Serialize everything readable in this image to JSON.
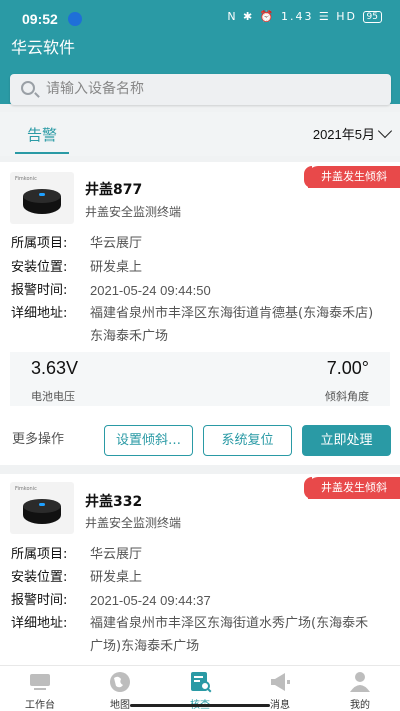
{
  "status": {
    "time": "09:52",
    "right": "N ✱ ⏰ 1.43 ☰ HD",
    "battery": "95"
  },
  "app": {
    "title": "华云软件"
  },
  "search": {
    "placeholder": "请输入设备名称"
  },
  "tabs": {
    "alarm": "告警",
    "date": "2021年5月"
  },
  "labels": {
    "project": "所属项目:",
    "location": "安装位置:",
    "alarm_time": "报警时间:",
    "address": "详细地址:",
    "battery": "电池电压",
    "tilt": "倾斜角度",
    "more": "更多操作",
    "set_tilt": "设置倾斜…",
    "reset": "系统复位",
    "handle": "立即处理"
  },
  "cards": [
    {
      "brand": "Fimkonic",
      "name": "井盖877",
      "type": "井盖安全监测终端",
      "tag": "井盖发生倾斜",
      "project": "华云展厅",
      "location": "研发桌上",
      "alarm_time": "2021-05-24 09:44:50",
      "address": "福建省泉州市丰泽区东海街道肯德基(东海泰禾店)东海泰禾广场",
      "battery_value": "3.63V",
      "tilt_value": "7.00°"
    },
    {
      "brand": "Fimkonic",
      "name": "井盖332",
      "type": "井盖安全监测终端",
      "tag": "井盖发生倾斜",
      "project": "华云展厅",
      "location": "研发桌上",
      "alarm_time": "2021-05-24 09:44:37",
      "address": "福建省泉州市丰泽区东海街道水秀广场(东海泰禾广场)东海泰禾广场"
    }
  ],
  "nav": [
    {
      "label": "工作台",
      "icon": "monitor-icon"
    },
    {
      "label": "地图",
      "icon": "globe-icon"
    },
    {
      "label": "核查",
      "icon": "check-icon"
    },
    {
      "label": "消息",
      "icon": "megaphone-icon"
    },
    {
      "label": "我的",
      "icon": "user-icon"
    }
  ],
  "colors": {
    "accent": "#2a9aa5",
    "alert": "#e8494a"
  }
}
